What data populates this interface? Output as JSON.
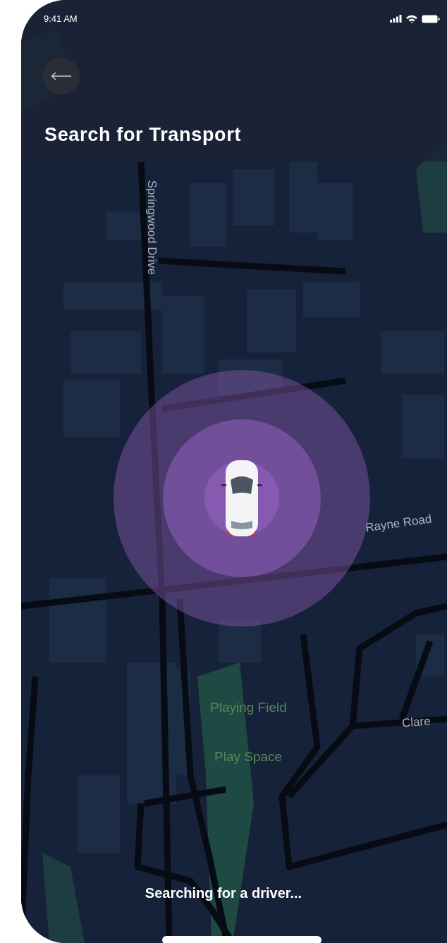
{
  "status_bar": {
    "time": "9:41 AM"
  },
  "header": {
    "title": "Search for Transport"
  },
  "map": {
    "labels": [
      {
        "text": "Springwood Drive",
        "kind": "street"
      },
      {
        "text": "Rayne Road",
        "kind": "street"
      },
      {
        "text": "Playing Field",
        "kind": "park"
      },
      {
        "text": "Play Space",
        "kind": "park"
      },
      {
        "text": "Clare",
        "kind": "street"
      }
    ]
  },
  "status_message": "Searching for a driver..."
}
